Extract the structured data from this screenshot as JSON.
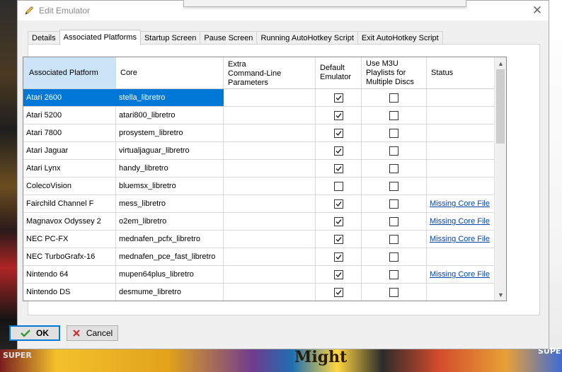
{
  "window": {
    "title": "Edit Emulator",
    "close_glyph": "✕"
  },
  "tabs": [
    {
      "label": "Details",
      "active": false
    },
    {
      "label": "Associated Platforms",
      "active": true
    },
    {
      "label": "Startup Screen",
      "active": false
    },
    {
      "label": "Pause Screen",
      "active": false
    },
    {
      "label": "Running AutoHotkey Script",
      "active": false
    },
    {
      "label": "Exit AutoHotkey Script",
      "active": false
    }
  ],
  "grid": {
    "columns": {
      "platform": "Associated Platform",
      "core": "Core",
      "extra_cmd": [
        "Extra",
        "Command-Line",
        "Parameters"
      ],
      "default_emulator": [
        "Default",
        "Emulator"
      ],
      "m3u": [
        "Use M3U",
        "Playlists for",
        "Multiple Discs"
      ],
      "status": "Status"
    },
    "rows": [
      {
        "platform": "Atari 2600",
        "core": "stella_libretro",
        "extra": "",
        "default": true,
        "m3u": false,
        "status": "",
        "selected": true
      },
      {
        "platform": "Atari 5200",
        "core": "atari800_libretro",
        "extra": "",
        "default": true,
        "m3u": false,
        "status": "",
        "selected": false
      },
      {
        "platform": "Atari 7800",
        "core": "prosystem_libretro",
        "extra": "",
        "default": true,
        "m3u": false,
        "status": "",
        "selected": false
      },
      {
        "platform": "Atari Jaguar",
        "core": "virtualjaguar_libretro",
        "extra": "",
        "default": true,
        "m3u": false,
        "status": "",
        "selected": false
      },
      {
        "platform": "Atari Lynx",
        "core": "handy_libretro",
        "extra": "",
        "default": true,
        "m3u": false,
        "status": "",
        "selected": false
      },
      {
        "platform": "ColecoVision",
        "core": "bluemsx_libretro",
        "extra": "",
        "default": false,
        "m3u": false,
        "status": "",
        "selected": false
      },
      {
        "platform": "Fairchild Channel F",
        "core": "mess_libretro",
        "extra": "",
        "default": true,
        "m3u": false,
        "status": "Missing Core File",
        "selected": false
      },
      {
        "platform": "Magnavox Odyssey 2",
        "core": "o2em_libretro",
        "extra": "",
        "default": true,
        "m3u": false,
        "status": "Missing Core File",
        "selected": false
      },
      {
        "platform": "NEC PC-FX",
        "core": "mednafen_pcfx_libretro",
        "extra": "",
        "default": true,
        "m3u": false,
        "status": "Missing Core File",
        "selected": false
      },
      {
        "platform": "NEC TurboGrafx-16",
        "core": "mednafen_pce_fast_libretro",
        "extra": "",
        "default": true,
        "m3u": false,
        "status": "",
        "selected": false
      },
      {
        "platform": "Nintendo 64",
        "core": "mupen64plus_libretro",
        "extra": "",
        "default": true,
        "m3u": false,
        "status": "Missing Core File",
        "selected": false
      },
      {
        "platform": "Nintendo DS",
        "core": "desmume_libretro",
        "extra": "",
        "default": true,
        "m3u": false,
        "status": "",
        "selected": false
      }
    ]
  },
  "buttons": {
    "ok": "OK",
    "cancel": "Cancel"
  },
  "background": {
    "strip_text_left": "SUPER",
    "strip_text_mid": "Might",
    "strip_text_right": "SUPE"
  },
  "colors": {
    "selection": "#0078d7",
    "header_highlight": "#cce4f7",
    "link": "#0645ad",
    "ok_check": "#2e9b3a",
    "cancel_x": "#d22b2b"
  },
  "icons": {
    "title": "pencil-icon",
    "ok": "checkmark-icon",
    "cancel": "x-icon"
  }
}
